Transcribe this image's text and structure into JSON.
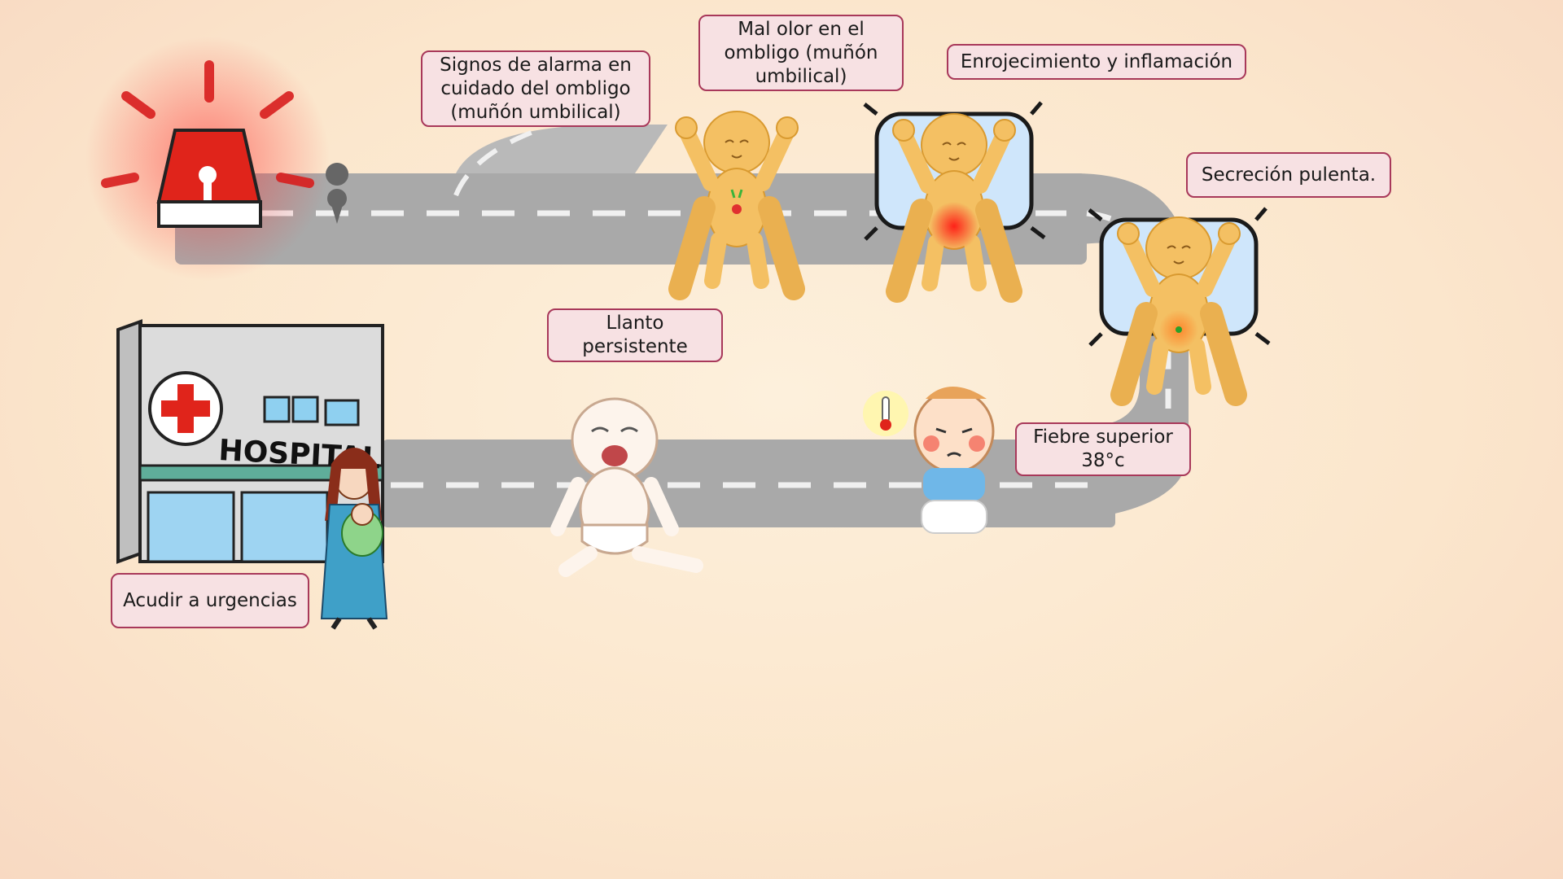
{
  "title": "Signos de alarma en cuidado del ombligo (muñón umbilical)",
  "steps": {
    "mal_olor": "Mal olor en el ombligo (muñón umbilical)",
    "enrojecimiento": "Enrojecimiento y inflamación",
    "secrecion": "Secreción pulenta.",
    "fiebre": "Fiebre superior 38°c",
    "llanto": "Llanto persistente",
    "urgencias": "Acudir a urgencias"
  },
  "hospital_sign": "HOSPITAL",
  "colors": {
    "label_bg": "#f7e1e3",
    "label_border": "#a8385a",
    "road": "#a9a9a9",
    "alarm_red": "#e0241b",
    "baby_skin": "#f4c063",
    "pillow": "#cfe6fb"
  },
  "icons": [
    "alarm-siren-icon",
    "map-pin-icon",
    "hospital-icon",
    "mother-with-baby-icon",
    "crying-baby-icon",
    "feverish-baby-icon",
    "thermometer-icon"
  ]
}
